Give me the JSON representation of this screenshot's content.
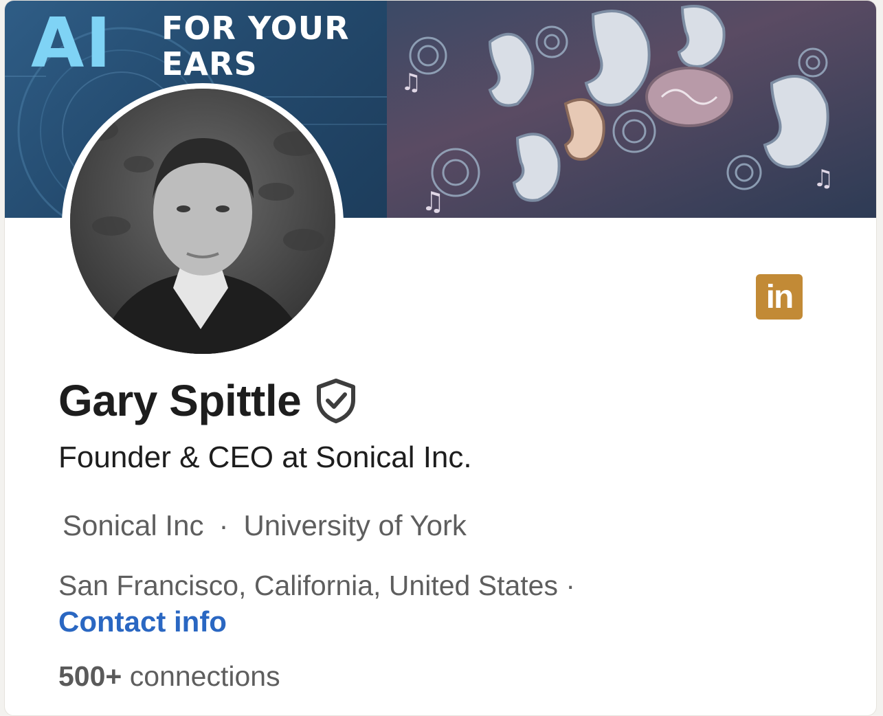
{
  "banner": {
    "headline_big": "AI",
    "headline_line1": "FOR YOUR",
    "headline_line2": "EARS"
  },
  "profile": {
    "name": "Gary Spittle",
    "headline": "Founder & CEO at Sonical Inc.",
    "company": "Sonical Inc",
    "separator": "·",
    "school": "University of York",
    "location": "San Francisco, California, United States ·",
    "contact_link": "Contact info",
    "connections_count": "500+",
    "connections_label": "connections"
  },
  "linkedin_badge": {
    "label": "in",
    "icon": "linkedin-icon",
    "color": "#c28a36"
  },
  "colors": {
    "link": "#2a67c2",
    "text_primary": "#1d1d1d",
    "text_secondary": "#5e5e5e",
    "banner_accent": "#7fd3f5"
  }
}
